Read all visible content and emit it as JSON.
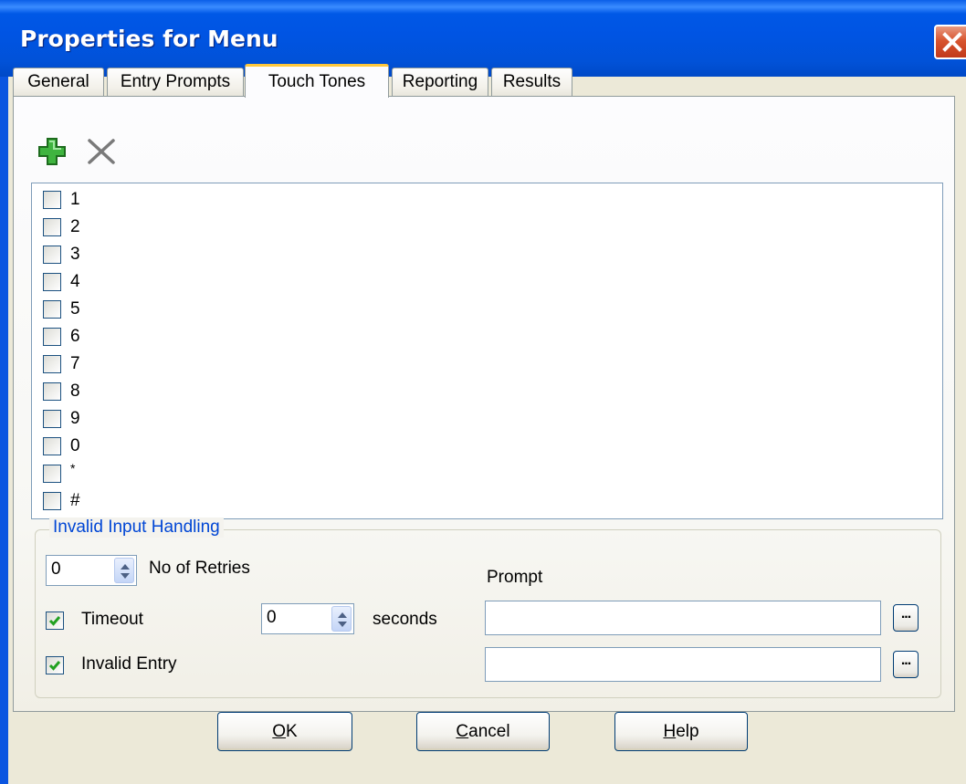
{
  "window": {
    "title": "Properties for Menu",
    "close_icon": "close-icon"
  },
  "tabs": [
    {
      "label": "General"
    },
    {
      "label": "Entry Prompts"
    },
    {
      "label": "Touch Tones",
      "active": true
    },
    {
      "label": "Reporting"
    },
    {
      "label": "Results"
    }
  ],
  "toolbar": {
    "add_icon": "plus-icon",
    "delete_icon": "delete-icon"
  },
  "tones": [
    {
      "label": "1",
      "checked": false
    },
    {
      "label": "2",
      "checked": false
    },
    {
      "label": "3",
      "checked": false
    },
    {
      "label": "4",
      "checked": false
    },
    {
      "label": "5",
      "checked": false
    },
    {
      "label": "6",
      "checked": false
    },
    {
      "label": "7",
      "checked": false
    },
    {
      "label": "8",
      "checked": false
    },
    {
      "label": "9",
      "checked": false
    },
    {
      "label": "0",
      "checked": false
    },
    {
      "label": "*",
      "checked": false
    },
    {
      "label": "#",
      "checked": false
    }
  ],
  "invalid_input": {
    "legend": "Invalid Input Handling",
    "retries_value": "0",
    "retries_label": "No of Retries",
    "prompt_header": "Prompt",
    "timeout_label": "Timeout",
    "timeout_checked": true,
    "timeout_value": "0",
    "seconds_label": "seconds",
    "timeout_prompt": "",
    "invalid_entry_label": "Invalid Entry",
    "invalid_entry_checked": true,
    "invalid_entry_prompt": "",
    "browse_label": "..."
  },
  "buttons": {
    "ok_mnemonic": "O",
    "ok_rest": "K",
    "cancel_mnemonic": "C",
    "cancel_rest": "ancel",
    "help_mnemonic": "H",
    "help_rest": "elp"
  },
  "colors": {
    "titlebar": "#0054e3",
    "dialog_bg": "#ece9d8",
    "tab_highlight": "#ffc83c",
    "group_legend": "#0046d5",
    "check_green": "#21a121"
  }
}
